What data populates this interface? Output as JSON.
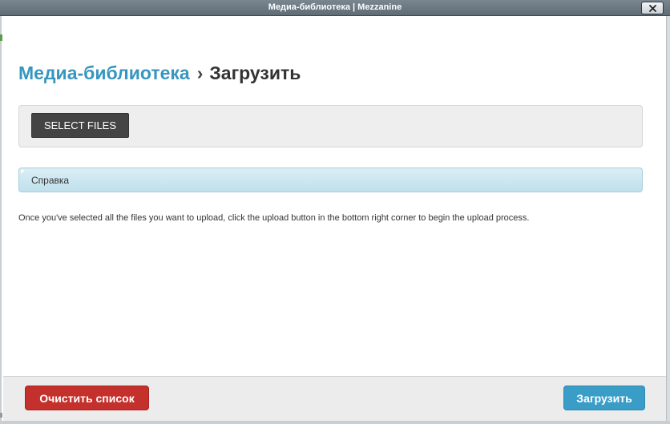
{
  "window": {
    "title": "Медиа-библиотека | Mezzanine",
    "close_icon": "close-icon"
  },
  "breadcrumb": {
    "parent": "Медиа-библиотека",
    "separator": "›",
    "current": "Загрузить"
  },
  "upload": {
    "select_files_label": "SELECT FILES"
  },
  "help": {
    "title": "Справка",
    "text": "Once you've selected all the files you want to upload, click the upload button in the bottom right corner to begin the upload process."
  },
  "footer": {
    "clear_label": "Очистить список",
    "upload_label": "Загрузить"
  },
  "colors": {
    "link": "#3696bf",
    "danger": "#c4302b",
    "primary": "#3a9dc8",
    "dark_button": "#444444"
  }
}
